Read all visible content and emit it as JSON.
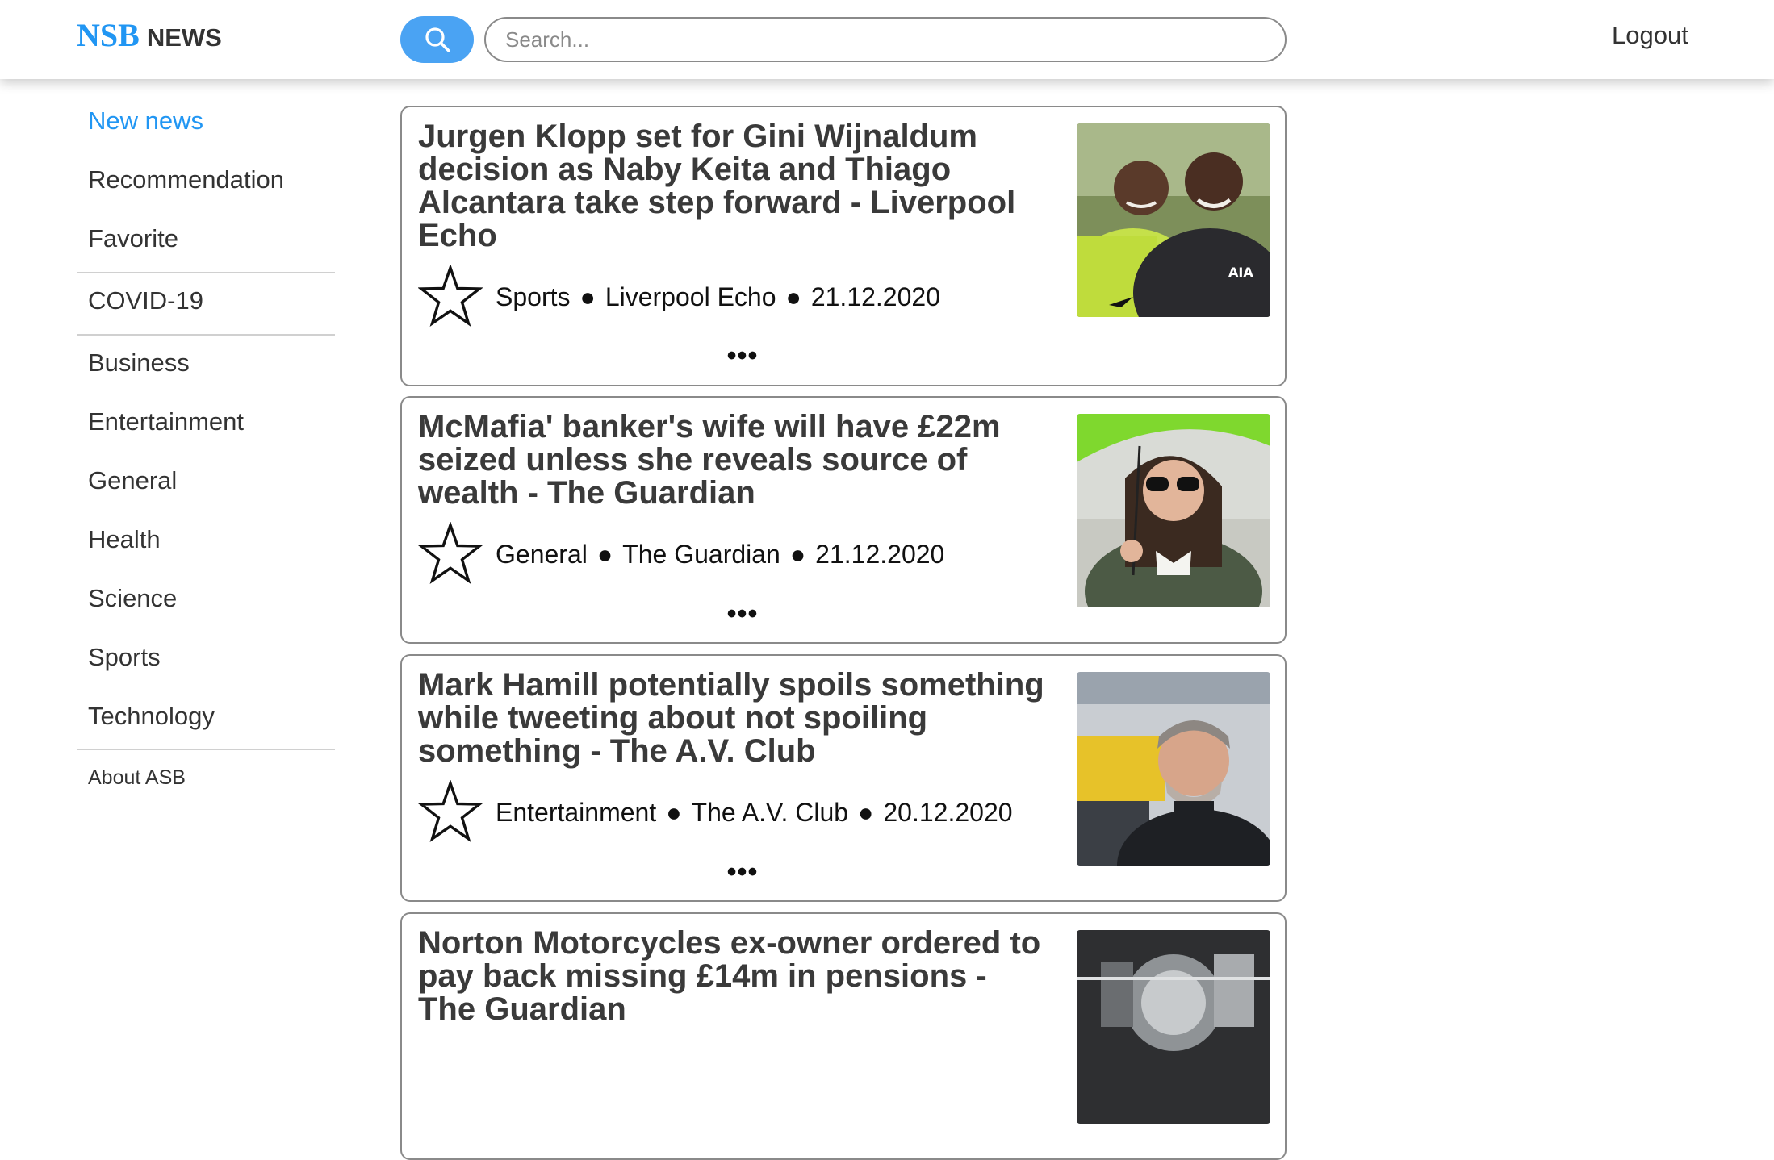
{
  "header": {
    "logo_brand": "NSB",
    "logo_news": "NEWS",
    "search_placeholder": "Search...",
    "logout_label": "Logout",
    "accent_color": "#2196f3"
  },
  "sidebar": {
    "items": [
      {
        "label": "New news",
        "active": true
      },
      {
        "label": "Recommendation"
      },
      {
        "label": "Favorite"
      },
      {
        "label": "COVID-19"
      },
      {
        "label": "Business"
      },
      {
        "label": "Entertainment"
      },
      {
        "label": "General"
      },
      {
        "label": "Health"
      },
      {
        "label": "Science"
      },
      {
        "label": "Sports"
      },
      {
        "label": "Technology"
      },
      {
        "label": "About ASB"
      }
    ]
  },
  "articles": [
    {
      "title": "Jurgen Klopp set for Gini Wijnaldum decision as Naby Keita and Thiago Alcantara take step forward - Liverpool Echo",
      "category": "Sports",
      "source": "Liverpool Echo",
      "date": "21.12.2020",
      "more": "•••",
      "image": "football-players-photo"
    },
    {
      "title": "McMafia' banker's wife will have £22m seized unless she reveals source of wealth - The Guardian",
      "category": "General",
      "source": "The Guardian",
      "date": "21.12.2020",
      "more": "•••",
      "image": "woman-with-umbrella-photo"
    },
    {
      "title": "Mark Hamill potentially spoils something while tweeting about not spoiling something - The A.V. Club",
      "category": "Entertainment",
      "source": "The A.V. Club",
      "date": "20.12.2020",
      "more": "•••",
      "image": "comic-con-man-photo"
    },
    {
      "title": "Norton Motorcycles ex-owner ordered to pay back missing £14m in pensions - The Guardian",
      "category": "",
      "source": "",
      "date": "",
      "more": "",
      "image": "motorcycle-engine-photo"
    }
  ]
}
